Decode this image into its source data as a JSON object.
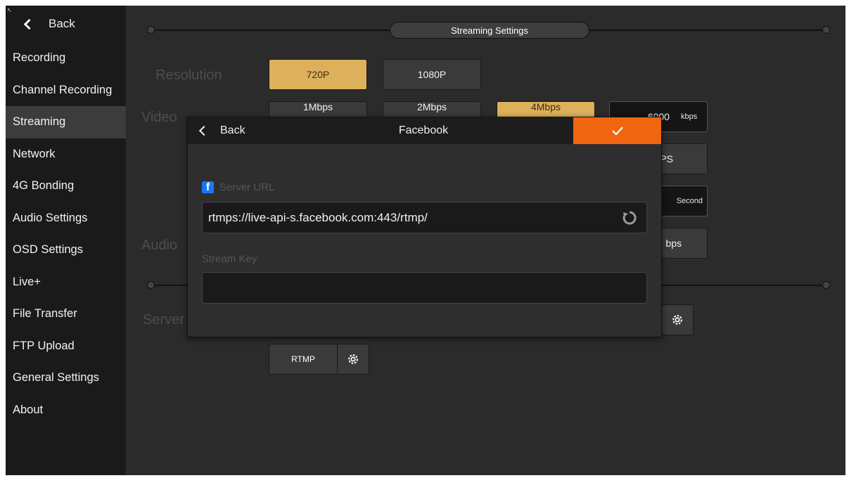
{
  "sidebar": {
    "back_label": "Back",
    "items": [
      {
        "label": "Recording"
      },
      {
        "label": "Channel Recording"
      },
      {
        "label": "Streaming"
      },
      {
        "label": "Network"
      },
      {
        "label": "4G Bonding"
      },
      {
        "label": "Audio Settings"
      },
      {
        "label": "OSD Settings"
      },
      {
        "label": "Live+"
      },
      {
        "label": "File Transfer"
      },
      {
        "label": "FTP Upload"
      },
      {
        "label": "General Settings"
      },
      {
        "label": "About"
      }
    ],
    "active_item": "Streaming"
  },
  "main": {
    "section_title": "Streaming Settings",
    "resolution": {
      "label": "Resolution",
      "options": [
        "720P",
        "1080P"
      ],
      "selected": "720P"
    },
    "video_bitrate": {
      "label": "Video Bitrate",
      "visible_label": "Video",
      "options": [
        "1Mbps",
        "2Mbps",
        "4Mbps"
      ],
      "selected": "4Mbps",
      "custom_value": "6000",
      "custom_unit": "kbps"
    },
    "partial_fields": {
      "fps_suffix": "PS",
      "gop_unit": "Second",
      "audio_unit": "bps"
    },
    "audio_label": "Audio",
    "server_label": "Server",
    "rtmp_button_label": "RTMP"
  },
  "dialog": {
    "back_label": "Back",
    "title": "Facebook",
    "server_url_label": "Server URL",
    "server_url_value": "rtmps://live-api-s.facebook.com:443/rtmp/",
    "stream_key_label": "Stream Key",
    "stream_key_value": "",
    "accent_color": "#f0650f"
  },
  "colors": {
    "selected_option": "#ddb15c",
    "facebook_blue": "#1877f2"
  }
}
